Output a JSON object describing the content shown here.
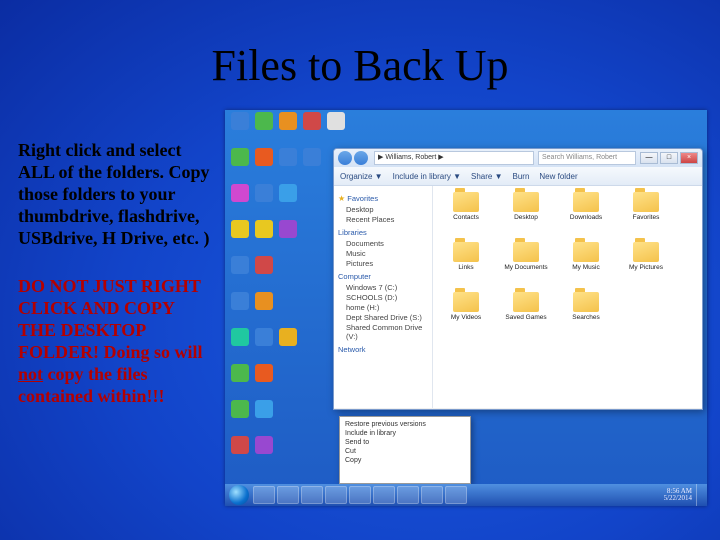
{
  "title": "Files to Back Up",
  "para1": "Right click and select ALL of the folders. Copy those folders to your thumbdrive, flashdrive, USBdrive, H Drive, etc. )",
  "para2_a": "DO NOT JUST RIGHT CLICK AND COPY THE DESKTOP FOLDER! Doing so will ",
  "para2_u": "not",
  "para2_b": " copy the files contained within!!!",
  "explorer": {
    "address": "▶ Williams, Robert ▶",
    "searchPlaceholder": "Search Williams, Robert",
    "toolbar": {
      "organize": "Organize ▼",
      "include": "Include in library ▼",
      "share": "Share ▼",
      "burn": "Burn",
      "newfolder": "New folder"
    },
    "sidebar": {
      "fav": "Favorites",
      "desk": "Desktop",
      "recent": "Recent Places",
      "lib": "Libraries",
      "doc": "Documents",
      "mus": "Music",
      "pic": "Pictures",
      "comp": "Computer",
      "c": "Windows 7 (C:)",
      "d": "SCHOOLS (D:)",
      "h": "home (H:)",
      "s": "Dept Shared Drive (S:)",
      "v": "Shared Common Drive (V:)",
      "net": "Network"
    },
    "folders": [
      "Contacts",
      "Desktop",
      "Downloads",
      "Favorites",
      "Links",
      "My Documents",
      "My Music",
      "My Pictures",
      "My Videos",
      "Saved Games",
      "Searches"
    ],
    "userfolder": "Robert"
  },
  "clock": {
    "time": "8:56 AM",
    "date": "5/22/2014"
  },
  "desktop_icons": [
    [
      "#3a7fd8",
      "#4cb84c",
      "#e89020",
      "#d04848",
      "#e0e0e0"
    ],
    [
      "#4cb84c",
      "#e85a20",
      "#3a7fd8",
      "#3a7fd8",
      ""
    ],
    [
      "#d048d0",
      "#3a7fd8",
      "#3a9fe8",
      "",
      ""
    ],
    [
      "#e8c820",
      "#e8c820",
      "#9848d0",
      "",
      ""
    ],
    [
      "#3a7fd8",
      "#d04848",
      "",
      "",
      ""
    ],
    [
      "#3a7fd8",
      "#e89020",
      "",
      "",
      ""
    ],
    [
      "#20c8a0",
      "#3a7fd8",
      "#e8b020",
      "",
      ""
    ],
    [
      "#4cb84c",
      "#e85a20",
      "",
      "",
      ""
    ],
    [
      "#4cb84c",
      "#3a9fe8",
      "",
      "",
      ""
    ],
    [
      "#d04848",
      "#9848d0",
      "",
      "",
      ""
    ]
  ],
  "dropdown": [
    "Restore previous versions",
    "Include in library",
    "Send to",
    "Cut",
    "Copy"
  ]
}
